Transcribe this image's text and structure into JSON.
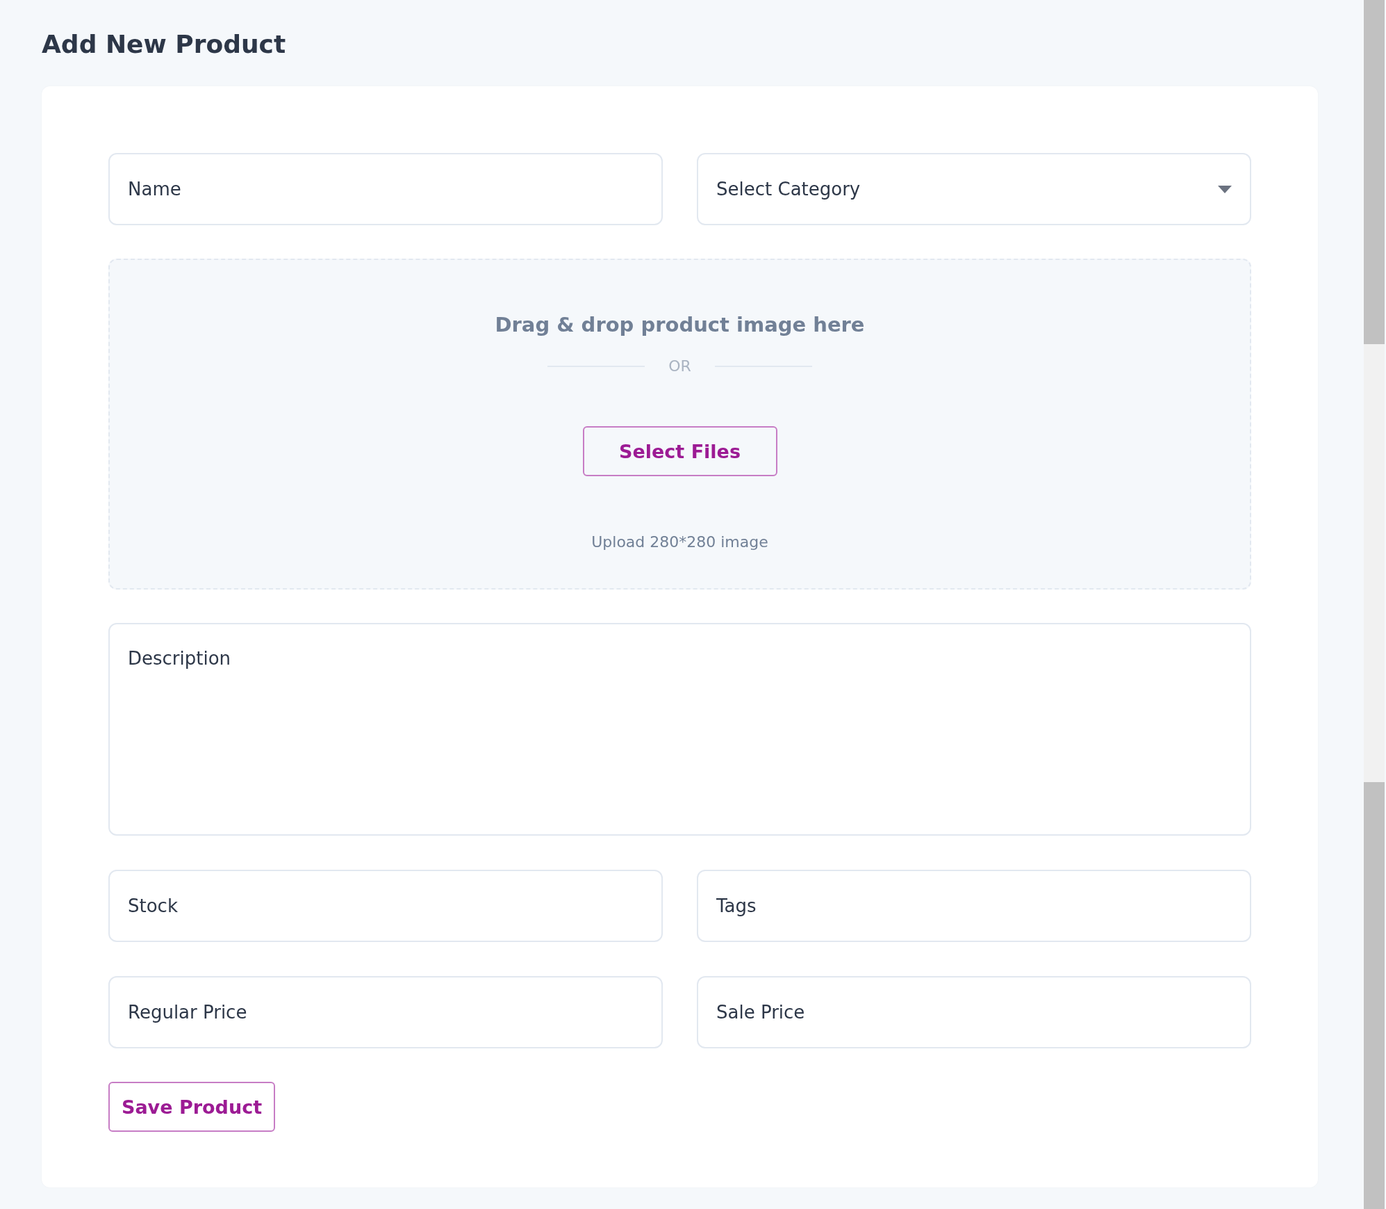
{
  "page_title": "Add New Product",
  "fields_top": [
    {
      "kind": "input",
      "placeholder": "Name"
    },
    {
      "kind": "select",
      "placeholder": "Select Category"
    }
  ],
  "upload": {
    "heading": "Drag & drop product image here",
    "divider": "OR",
    "button": "Select Files",
    "hint": "Upload 280*280 image"
  },
  "description": {
    "kind": "textarea",
    "placeholder": "Description"
  },
  "fields_bottom": [
    {
      "kind": "input",
      "placeholder": "Stock"
    },
    {
      "kind": "input",
      "placeholder": "Tags"
    },
    {
      "kind": "input",
      "placeholder": "Regular Price"
    },
    {
      "kind": "input",
      "placeholder": "Sale Price"
    }
  ],
  "save_button": "Save Product"
}
